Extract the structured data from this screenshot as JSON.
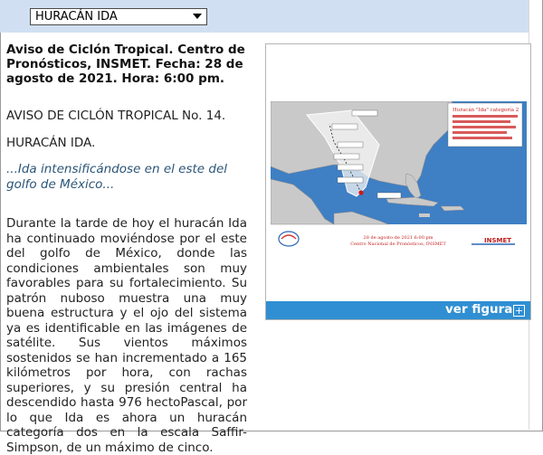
{
  "selector": {
    "selected": "HURACÁN IDA"
  },
  "heading": "Aviso de Ciclón Tropical. Centro de Pronósticos, INSMET. Fecha: 28 de agosto de 2021. Hora: 6:00 pm.",
  "notice_number": "AVISO DE CICLÓN TROPICAL No. 14.",
  "storm_name": "HURACÁN IDA.",
  "lead": "...Ida intensificándose en el este del golfo de México...",
  "body": "Durante la tarde de hoy el huracán Ida ha continuado moviéndose por el este del golfo de México, donde las condiciones ambientales son muy favorables para su fortalecimiento. Su patrón nuboso muestra una muy buena estructura y el ojo del sistema ya es identificable en las imágenes de satélite. Sus vientos máximos sostenidos se han incrementado a 165 kilómetros por hora, con rachas superiores, y su presión central ha descendido hasta 976 hectoPascal, por lo que Ida es ahora un huracán categoría dos en la escala Saffir-Simpson, de un máximo de cinco.",
  "figure": {
    "link_label": "ver figura",
    "plus_icon": "plus-icon",
    "map_title": "Huracán \"Ida\" categoría 2",
    "map_caption_line1": "28 de agosto de 2021 6:00 pm",
    "map_caption_line2": "Centro Nacional de Pronósticos, INSMET",
    "map_logo": "INSMET",
    "colors": {
      "bar": "#2f8fd2",
      "ocean": "#3f7fc4",
      "land": "#c9c9c9"
    }
  }
}
